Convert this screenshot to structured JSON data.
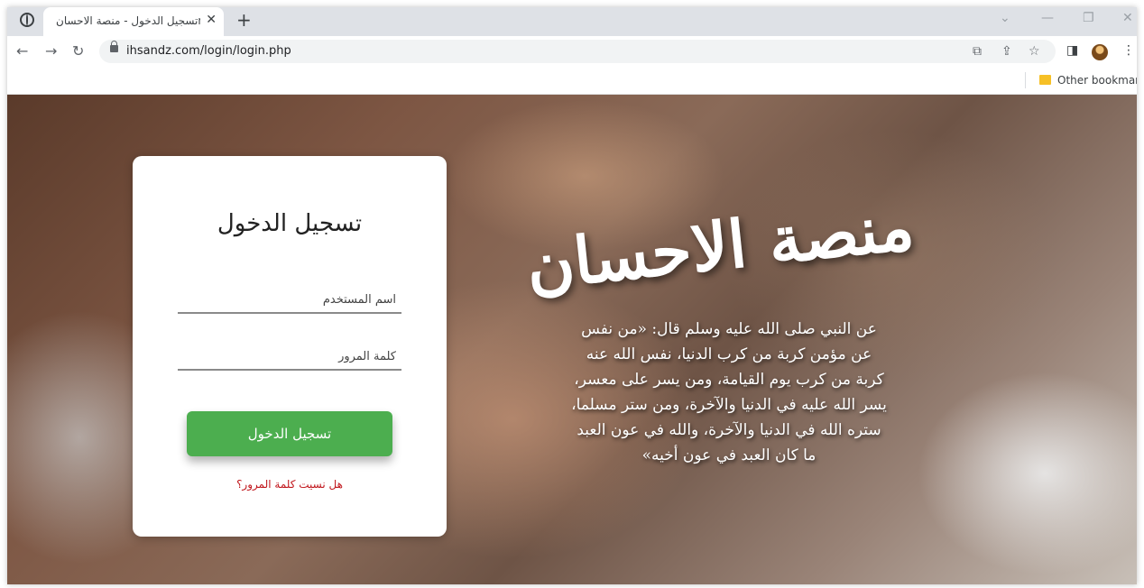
{
  "browser": {
    "tab_title": "تسجيل الدخول - منصة الاحسانn",
    "tab_close": "✕",
    "new_tab": "+",
    "url": "ihsandz.com/login/login.php",
    "bookmark_label": "Other bookmarks",
    "icons": [
      "globe-icon",
      "back-arrow-icon",
      "forward-arrow-icon",
      "reload-icon",
      "lock-icon",
      "translate-icon",
      "share-icon",
      "star-icon",
      "side-panel-icon",
      "profile-avatar",
      "menu-kebab-icon",
      "folder-icon"
    ]
  },
  "login": {
    "title": "تسجيل الدخول",
    "username_placeholder": "اسم المستخدم",
    "password_placeholder": "كلمة المرور",
    "submit_label": "تسجيل الدخول",
    "forgot_label": "هل نسيت كلمة المرور؟"
  },
  "hero": {
    "brand": "منصة الاحسان",
    "hadith": "عن النبي صلى الله عليه وسلم قال: «من نفس عن مؤمن كربة من كرب الدنيا، نفس الله عنه كربة من كرب يوم القيامة، ومن يسر على معسر، يسر الله عليه في الدنيا والآخرة، ومن ستر مسلما، ستره الله في الدنيا والآخرة، والله في عون العبد ما كان العبد في عون أخيه»"
  },
  "colors": {
    "button": "#4cae4f",
    "forgot_link": "#c0151b",
    "tab_strip": "#dee1e6"
  }
}
